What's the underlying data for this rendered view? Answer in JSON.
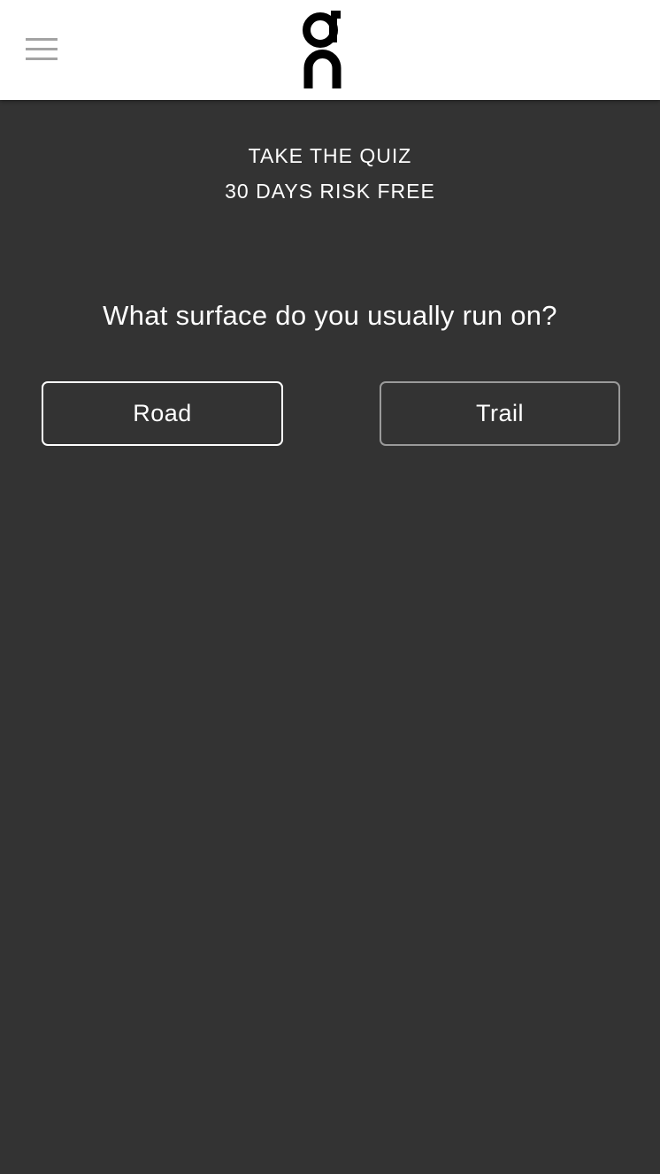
{
  "header": {
    "menu_icon": "hamburger-menu-icon",
    "logo_icon": "on-brand-logo",
    "background": "#ffffff",
    "logo_color": "#000000"
  },
  "quiz": {
    "tagline_1": "TAKE THE QUIZ",
    "tagline_2": "30 DAYS RISK FREE",
    "question": "What surface do you usually run on?",
    "options": [
      {
        "label": "Road"
      },
      {
        "label": "Trail"
      }
    ]
  },
  "colors": {
    "page_background": "#333333",
    "text": "#ffffff",
    "road_border": "#ffffff",
    "trail_border": "#9a9a9a"
  }
}
